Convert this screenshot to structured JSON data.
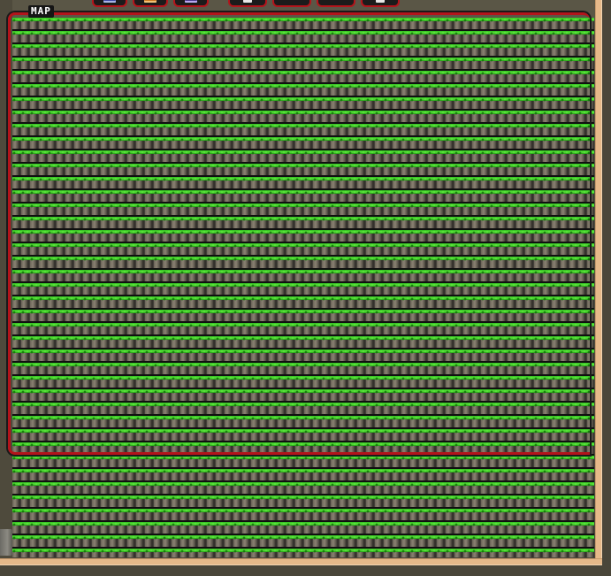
{
  "map": {
    "label": "MAP"
  },
  "toolbar": {
    "buttons": [
      {
        "icon": "save-icon"
      },
      {
        "icon": "open-folder-icon"
      },
      {
        "icon": "disk-icon"
      },
      {
        "icon": "white-block-icon"
      },
      {
        "icon": "blank-icon"
      },
      {
        "icon": "blank-icon"
      },
      {
        "icon": "white-block-icon"
      }
    ]
  },
  "colors": {
    "frame_red": "#b3141b",
    "grass_green": "#2fb81f",
    "rock_gray": "#6b6458",
    "border_beige": "#e6b98a",
    "background": "#4e4a3c"
  }
}
